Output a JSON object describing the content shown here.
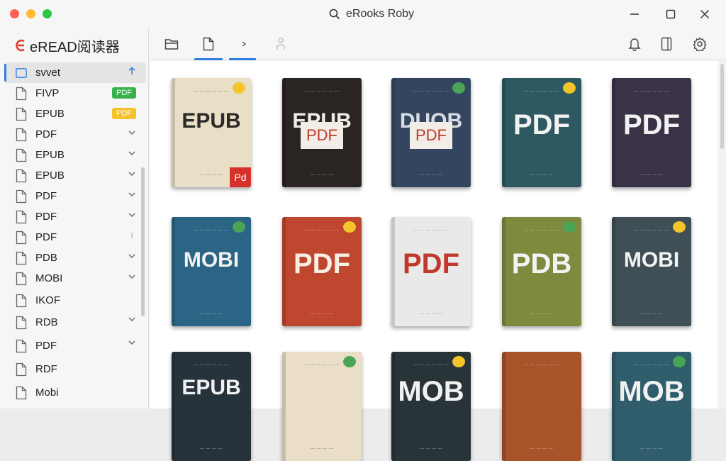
{
  "window": {
    "title": "eRooks Roby"
  },
  "app": {
    "brand": "eREAD阅读器"
  },
  "sidebar": {
    "items": [
      {
        "label": "svvet",
        "right": "arrow-up",
        "active": true
      },
      {
        "label": "FIVP",
        "badge": "PDF",
        "badge_color": "#35b24a"
      },
      {
        "label": "EPUB",
        "badge": "PDF",
        "badge_color": "#f6c22b"
      },
      {
        "label": "PDF",
        "right": "chevron"
      },
      {
        "label": "EPUB",
        "right": "chevron"
      },
      {
        "label": "EPUB",
        "right": "chevron"
      },
      {
        "label": "PDF",
        "right": "chevron"
      },
      {
        "label": "PDF",
        "right": "chevron"
      },
      {
        "label": "PDF",
        "right": "bar"
      },
      {
        "label": "PDB",
        "right": "chevron"
      },
      {
        "label": "MOBI",
        "right": "chevron"
      },
      {
        "label": "IKOF",
        "right": ""
      },
      {
        "label": "RDB",
        "right": "chevron"
      },
      {
        "label": "PDF",
        "right": "chevron"
      },
      {
        "label": "RDF",
        "right": ""
      },
      {
        "label": "Mobi",
        "right": ""
      }
    ]
  },
  "books": [
    {
      "label": "EPUB",
      "tag": "Pd",
      "bg": "#e8dfc6",
      "fg": "#2b2b2b"
    },
    {
      "label": "EPUB",
      "sub": "PDF",
      "bg": "#2a2422",
      "fg": "#f1ece4"
    },
    {
      "label": "DUOB",
      "sub": "PDF",
      "bg": "#34465f",
      "fg": "#d8dde4"
    },
    {
      "label": "PDF",
      "bg": "#2f5960",
      "fg": "#f2f2f2"
    },
    {
      "label": "PDF",
      "bg": "#3a3348",
      "fg": "#f2f2f2"
    },
    {
      "label": "MOBI",
      "bg": "#2b6585",
      "fg": "#f2f2f2"
    },
    {
      "label": "PDF",
      "bg": "#c0472f",
      "fg": "#f7efe4"
    },
    {
      "label": "PDF",
      "bg": "#e9e9e9",
      "fg": "#c0392b"
    },
    {
      "label": "PDB",
      "bg": "#7f8a3e",
      "fg": "#f3f3f3"
    },
    {
      "label": "MOBI",
      "bg": "#3f4f55",
      "fg": "#f3f3f3"
    },
    {
      "label": "EPUB",
      "bg": "#27333b",
      "fg": "#f1f1f1"
    },
    {
      "label": "",
      "bg": "#eadfc6",
      "fg": "#333"
    },
    {
      "label": "MOB",
      "bg": "#293439",
      "fg": "#f1f1f1"
    },
    {
      "label": "",
      "bg": "#a7542b",
      "fg": "#f7efe4"
    },
    {
      "label": "MOB",
      "bg": "#2f5d6b",
      "fg": "#f1f1f1"
    }
  ]
}
